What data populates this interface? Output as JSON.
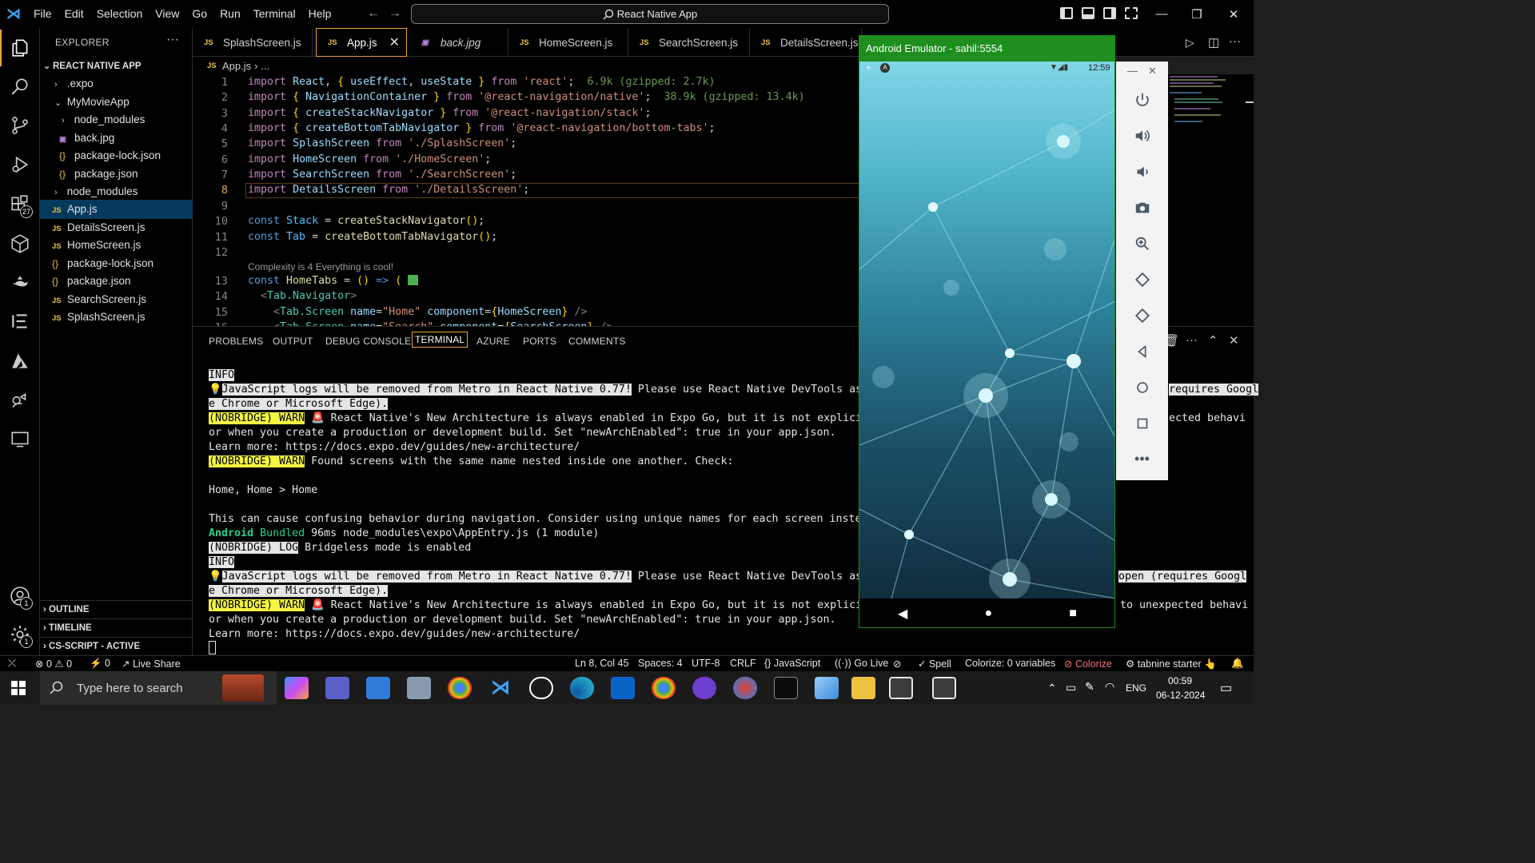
{
  "titlebar": {
    "menus": [
      "File",
      "Edit",
      "Selection",
      "View",
      "Go",
      "Run",
      "Terminal",
      "Help"
    ],
    "command_center": "React Native App"
  },
  "activity_badges": {
    "extensions": "27",
    "accounts": "1",
    "settings": "1"
  },
  "explorer": {
    "title": "EXPLORER",
    "root": "REACT NATIVE APP",
    "items": [
      {
        "label": ".expo",
        "type": "folder"
      },
      {
        "label": "MyMovieApp",
        "type": "folder-open"
      },
      {
        "label": "node_modules",
        "type": "folder"
      },
      {
        "label": "back.jpg",
        "type": "img"
      },
      {
        "label": "package-lock.json",
        "type": "json"
      },
      {
        "label": "package.json",
        "type": "json"
      },
      {
        "label": "node_modules",
        "type": "folder"
      },
      {
        "label": "App.js",
        "type": "js"
      },
      {
        "label": "DetailsScreen.js",
        "type": "js"
      },
      {
        "label": "HomeScreen.js",
        "type": "js"
      },
      {
        "label": "package-lock.json",
        "type": "json"
      },
      {
        "label": "package.json",
        "type": "json"
      },
      {
        "label": "SearchScreen.js",
        "type": "js"
      },
      {
        "label": "SplashScreen.js",
        "type": "js"
      }
    ],
    "sections": [
      "OUTLINE",
      "TIMELINE",
      "CS-SCRIPT - ACTIVE"
    ]
  },
  "tabs": [
    "SplashScreen.js",
    "App.js",
    "back.jpg",
    "HomeScreen.js",
    "SearchScreen.js",
    "DetailsScreen.js"
  ],
  "breadcrumb": {
    "file": "App.js",
    "rest": "..."
  },
  "editor": {
    "line_numbers": [
      "1",
      "2",
      "3",
      "4",
      "5",
      "6",
      "7",
      "8",
      "9",
      "10",
      "11",
      "12",
      "13",
      "14",
      "15",
      "16"
    ],
    "import_cost_1": "6.9k (gzipped: 2.7k)",
    "import_cost_2": "38.9k (gzipped: 13.4k)",
    "codelens": "Complexity is 4 Everything is cool!"
  },
  "panel": {
    "tabs": [
      "PROBLEMS",
      "OUTPUT",
      "DEBUG CONSOLE",
      "TERMINAL",
      "AZURE",
      "PORTS",
      "COMMENTS"
    ],
    "lines": {
      "info": "INFO",
      "js_logs_a": "JavaScript logs will be removed from Metro in React Native 0.77!",
      "js_logs_b": " Please use React Native DevTools as your d",
      "js_logs_tail": "requires Googl",
      "chrome": "e Chrome or Microsoft Edge).",
      "warn_tag": "(NOBRIDGE) WARN",
      "new_arch": " React Native's New Architecture is always enabled in Expo Go, but it is not explicitly ena",
      "new_arch_tail": "ected behavi",
      "prod_build": "or when you create a production or development build. Set \"newArchEnabled\": true in your app.json.",
      "learn_more": "Learn more: https://docs.expo.dev/guides/new-architecture/",
      "found_screens": " Found screens with the same name nested inside one another. Check:",
      "home_path": "Home, Home > Home",
      "confusing": "This can cause confusing behavior during navigation. Consider using unique names for each screen instead. [Comp",
      "bundled_android": "Android",
      "bundled_word": "Bundled",
      "bundled_rest": " 96ms node_modules\\expo\\AppEntry.js (1 module)",
      "log_tag": "(NOBRIDGE) LOG",
      "bridgeless": " Bridgeless mode is enabled",
      "js_logs_tail2": "open (requires Googl",
      "new_arch_tail2": "to unexpected behavi"
    }
  },
  "emulator": {
    "title": "Android Emulator - sahil:5554",
    "clock": "12:59"
  },
  "statusbar": {
    "errors": "0",
    "warnings": "0",
    "ports": "0",
    "live_share": "Live Share",
    "position": "Ln 8, Col 45",
    "spaces": "Spaces: 4",
    "encoding": "UTF-8",
    "eol": "CRLF",
    "language": "JavaScript",
    "go_live": "Go Live",
    "spell": "Spell",
    "colorize_vars": "Colorize: 0 variables",
    "colorize": "Colorize",
    "tabnine": "tabnine starter"
  },
  "taskbar": {
    "search_placeholder": "Type here to search",
    "language": "ENG",
    "time": "00:59",
    "date": "06-12-2024"
  }
}
